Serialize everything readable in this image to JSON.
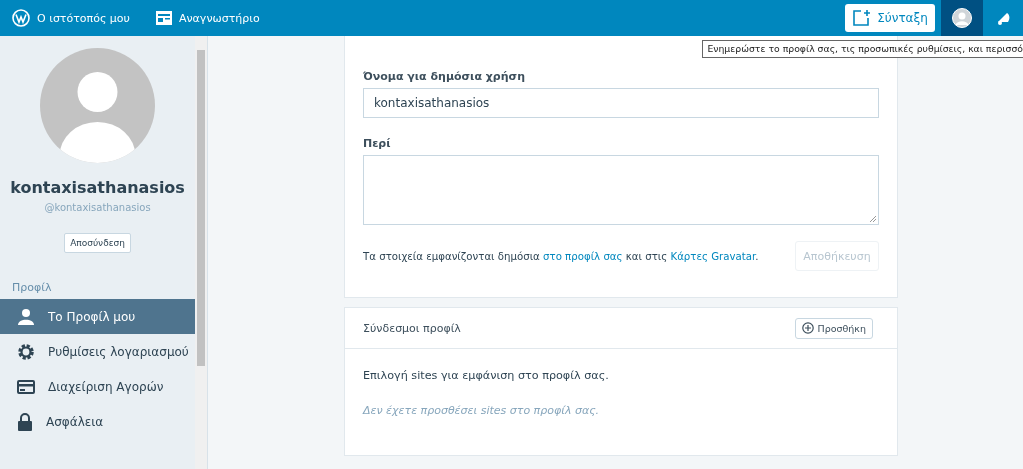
{
  "masterbar": {
    "items": [
      {
        "label": "Ο ιστότοπός μου"
      },
      {
        "label": "Αναγνωστήριο"
      }
    ],
    "write_button": "Σύνταξη",
    "tooltip": "Ενημερώστε το προφίλ σας, τις προσωπικές ρυθμίσεις, και περισσό"
  },
  "sidebar": {
    "display_name": "kontaxisathanasios",
    "handle": "@kontaxisathanasios",
    "logout": "Αποσύνδεση",
    "section": "Προφίλ",
    "items": [
      {
        "label": "Το Προφίλ μου",
        "selected": true
      },
      {
        "label": "Ρυθμίσεις λογαριασμού",
        "selected": false
      },
      {
        "label": "Διαχείριση Αγορών",
        "selected": false
      },
      {
        "label": "Ασφάλεια",
        "selected": false
      }
    ]
  },
  "profile_form": {
    "public_name_label": "Όνομα για δημόσια χρήση",
    "public_name": "kontaxisathanasios",
    "about_label": "Περί",
    "note_start": "Τα στοιχεία εμφανίζονται δημόσια",
    "profile_link": "στο προφίλ σας",
    "note_middle": "και στις",
    "gravatar_link": "Κάρτες Gravatar",
    "note_end": ".",
    "save_button": {
      "label": "Αποθήκευση",
      "disabled": true
    }
  },
  "profile_links": {
    "title": "Σύνδεσμοι προφίλ",
    "add_button": "Προσθήκη",
    "description": "Επιλογή sites για εμφάνιση στο προφίλ σας.",
    "empty": "Δεν έχετε προσθέσει sites στο προφίλ σας."
  }
}
